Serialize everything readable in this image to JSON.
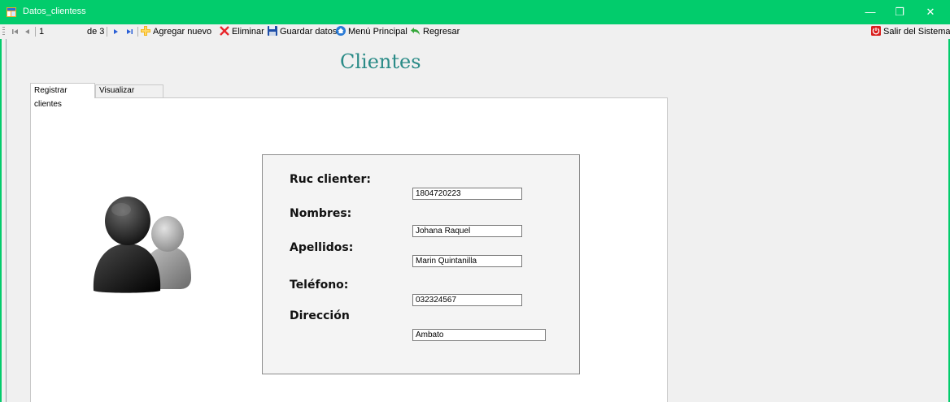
{
  "window": {
    "title": "Datos_clientess",
    "minimize_glyph": "—",
    "restore_glyph": "❐",
    "close_glyph": "✕"
  },
  "toolbar": {
    "position_value": "1",
    "count_label": "de 3",
    "add_label": "Agregar nuevo",
    "delete_label": "Eliminar",
    "save_label": "Guardar datos",
    "menu_label": "Menú Principal",
    "back_label": "Regresar",
    "exit_label": "Salir del Sistema"
  },
  "header": {
    "title": "Clientes"
  },
  "tabs": [
    {
      "label": "Registrar clientes",
      "active": true
    },
    {
      "label": "Visualizar Registro",
      "active": false
    }
  ],
  "form": {
    "ruc": {
      "label": "Ruc  clienter:",
      "value": "1804720223"
    },
    "nombres": {
      "label": "Nombres:",
      "value": "Johana Raquel"
    },
    "apellidos": {
      "label": "Apellidos:",
      "value": "Marin Quintanilla"
    },
    "telefono": {
      "label": "Teléfono:",
      "value": "032324567"
    },
    "direccion": {
      "label": "Dirección",
      "value": "Ambato"
    }
  },
  "icons": {
    "app": "form-app-icon",
    "first": "first-record-icon",
    "prev": "previous-record-icon",
    "next": "next-record-icon",
    "last": "last-record-icon",
    "add": "add-plus-icon",
    "delete": "delete-x-icon",
    "save": "floppy-disk-icon",
    "menu": "home-icon",
    "back": "undo-arrow-icon",
    "exit": "power-icon",
    "illustration": "users-icon"
  },
  "colors": {
    "titlebar": "#02cc6c",
    "title_text": "#2a8b87",
    "delete_red": "#e8262b",
    "save_blue": "#1f4fa8",
    "exit_red": "#d9201f"
  }
}
